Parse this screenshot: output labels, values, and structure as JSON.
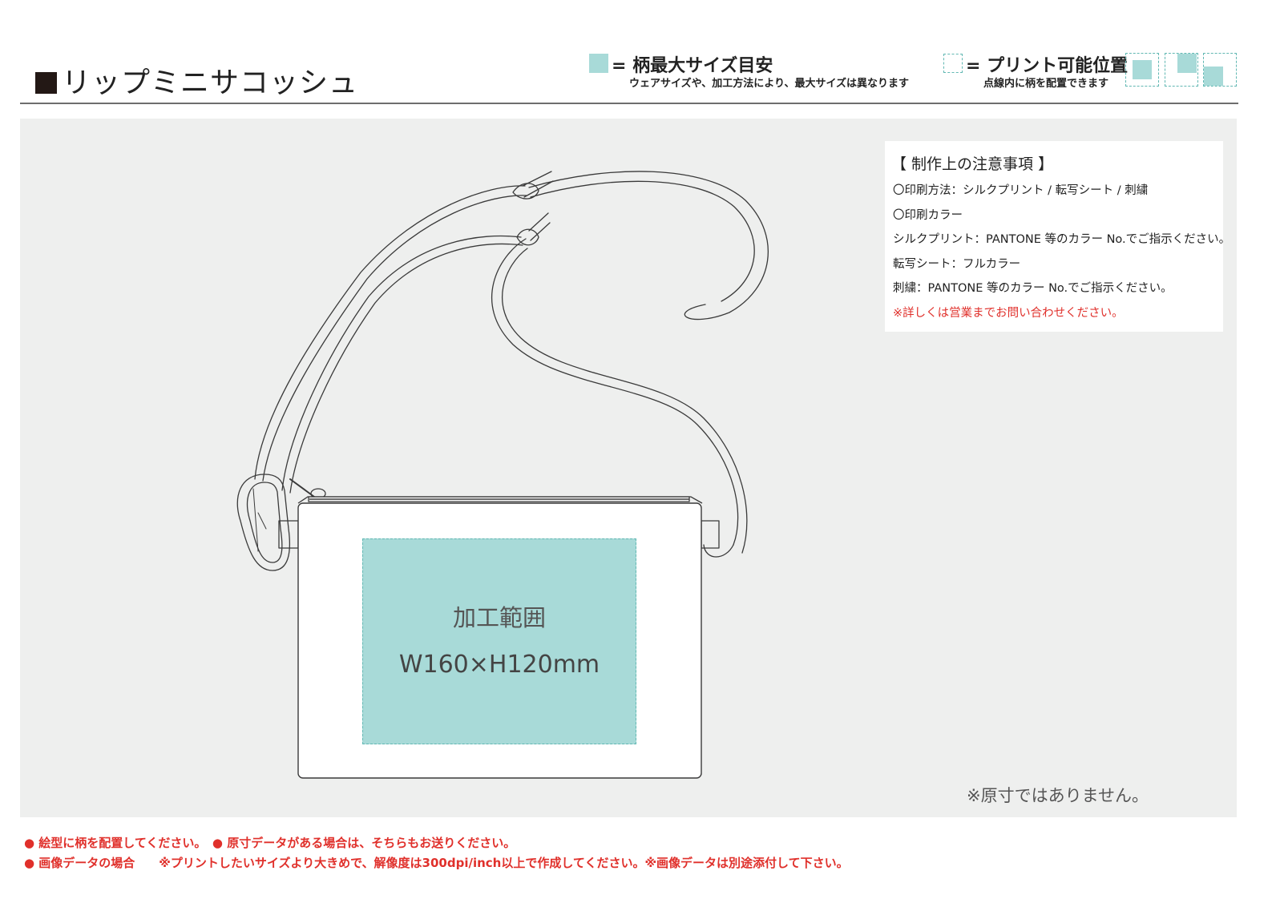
{
  "title": "リップミニサコッシュ",
  "legend": {
    "max_size": {
      "label": "= 柄最大サイズ目安",
      "note": "ウェアサイズや、加工方法により、最大サイズは異なります",
      "color": "#a8dad8"
    },
    "print_position": {
      "label": "= プリント可能位置",
      "note": "点線内に柄を配置できます",
      "border_color": "#62b8b3"
    }
  },
  "notes": {
    "title": "【 制作上の注意事項 】",
    "lines": [
      "〇印刷方法：シルクプリント / 転写シート / 刺繍",
      "〇印刷カラー",
      "シルクプリント：PANTONE 等のカラー No.でご指示ください。",
      "転写シート：フルカラー",
      "刺繍：PANTONE 等のカラー No.でご指示ください。"
    ],
    "warning": "※詳しくは営業までお問い合わせください。",
    "warning_color": "#e0302b"
  },
  "print_area": {
    "label": "加工範囲",
    "size": "W160×H120mm"
  },
  "disclaimer": "※原寸ではありません。",
  "footer": {
    "line1": "● 絵型に柄を配置してください。　● 原寸データがある場合は、そちらもお送りください。",
    "line2": "● 画像データの場合　　※プリントしたいサイズより大きめで、解像度は300dpi/inch以上で作成してください。※画像データは別途添付して下さい。",
    "color": "#e0302b"
  }
}
